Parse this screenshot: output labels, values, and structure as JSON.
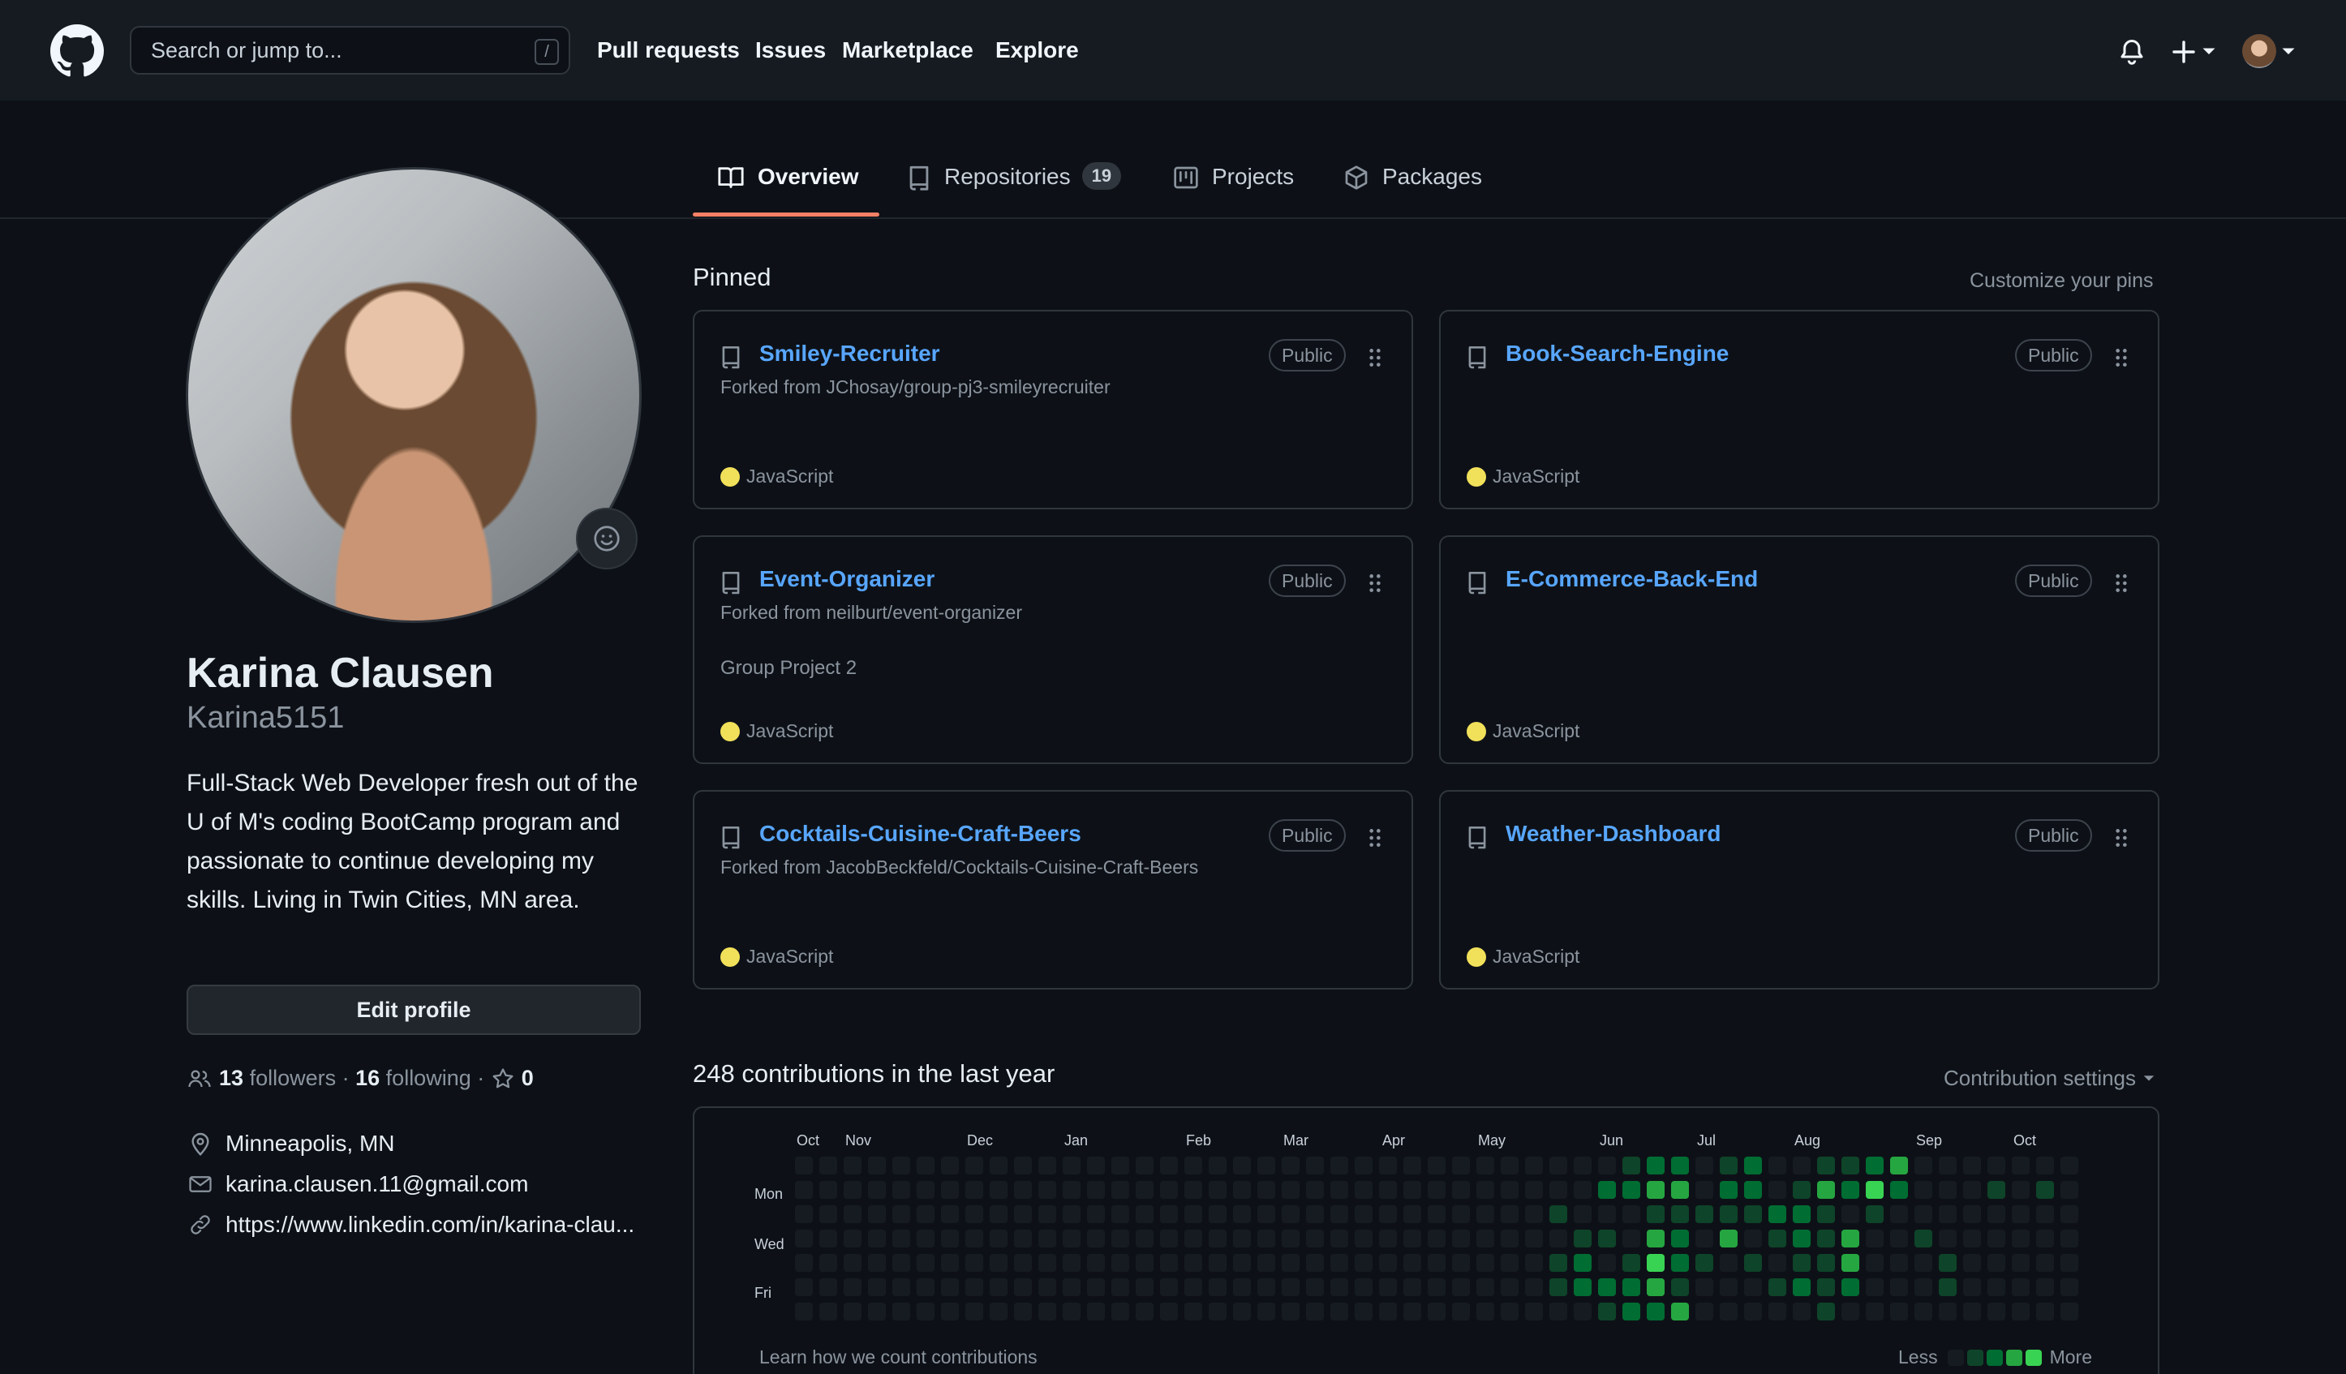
{
  "header": {
    "search_placeholder": "Search or jump to...",
    "slash_key": "/",
    "nav": [
      "Pull requests",
      "Issues",
      "Marketplace",
      "Explore"
    ]
  },
  "tabs": [
    {
      "label": "Overview",
      "active": true
    },
    {
      "label": "Repositories",
      "count": "19"
    },
    {
      "label": "Projects"
    },
    {
      "label": "Packages"
    }
  ],
  "profile": {
    "full_name": "Karina Clausen",
    "username": "Karina5151",
    "bio": "Full-Stack Web Developer fresh out of the U of M's coding BootCamp program and passionate to continue developing my skills. Living in Twin Cities, MN area.",
    "edit_label": "Edit profile",
    "followers_count": "13",
    "followers_label": "followers",
    "following_count": "16",
    "following_label": "following",
    "stars_count": "0",
    "location": "Minneapolis, MN",
    "email": "karina.clausen.11@gmail.com",
    "website": "https://www.linkedin.com/in/karina-clau..."
  },
  "pinned": {
    "title": "Pinned",
    "customize_label": "Customize your pins",
    "cards": [
      {
        "name": "Smiley-Recruiter",
        "visibility": "Public",
        "forked_from": "Forked from JChosay/group-pj3-smileyrecruiter",
        "description": "",
        "language": "JavaScript"
      },
      {
        "name": "Book-Search-Engine",
        "visibility": "Public",
        "forked_from": "",
        "description": "",
        "language": "JavaScript"
      },
      {
        "name": "Event-Organizer",
        "visibility": "Public",
        "forked_from": "Forked from neilburt/event-organizer",
        "description": "Group Project 2",
        "language": "JavaScript"
      },
      {
        "name": "E-Commerce-Back-End",
        "visibility": "Public",
        "forked_from": "",
        "description": "",
        "language": "JavaScript"
      },
      {
        "name": "Cocktails-Cuisine-Craft-Beers",
        "visibility": "Public",
        "forked_from": "Forked from JacobBeckfeld/Cocktails-Cuisine-Craft-Beers",
        "description": "",
        "language": "JavaScript"
      },
      {
        "name": "Weather-Dashboard",
        "visibility": "Public",
        "forked_from": "",
        "description": "",
        "language": "JavaScript"
      }
    ],
    "language_color": "#f1e05a"
  },
  "contributions": {
    "title": "248 contributions in the last year",
    "settings_label": "Contribution settings",
    "months": [
      "Oct",
      "Nov",
      "Dec",
      "Jan",
      "Feb",
      "Mar",
      "Apr",
      "May",
      "Jun",
      "Jul",
      "Aug",
      "Sep",
      "Oct"
    ],
    "days": [
      "Mon",
      "Wed",
      "Fri"
    ],
    "learn_label": "Learn how we count contributions",
    "legend_less": "Less",
    "legend_more": "More",
    "level_colors": [
      "#161b22",
      "#0e4429",
      "#006d32",
      "#26a641",
      "#39d353"
    ],
    "active_cells": [
      [
        31,
        2,
        1
      ],
      [
        31,
        4,
        1
      ],
      [
        31,
        5,
        1
      ],
      [
        32,
        3,
        1
      ],
      [
        32,
        4,
        2
      ],
      [
        32,
        5,
        2
      ],
      [
        33,
        1,
        2
      ],
      [
        33,
        3,
        1
      ],
      [
        33,
        5,
        2
      ],
      [
        33,
        6,
        1
      ],
      [
        34,
        0,
        1
      ],
      [
        34,
        1,
        2
      ],
      [
        34,
        4,
        1
      ],
      [
        34,
        5,
        2
      ],
      [
        34,
        6,
        2
      ],
      [
        35,
        0,
        2
      ],
      [
        35,
        1,
        3
      ],
      [
        35,
        2,
        1
      ],
      [
        35,
        3,
        3
      ],
      [
        35,
        4,
        4
      ],
      [
        35,
        5,
        3
      ],
      [
        35,
        6,
        2
      ],
      [
        36,
        0,
        2
      ],
      [
        36,
        1,
        3
      ],
      [
        36,
        2,
        1
      ],
      [
        36,
        3,
        2
      ],
      [
        36,
        4,
        2
      ],
      [
        36,
        5,
        1
      ],
      [
        36,
        6,
        3
      ],
      [
        37,
        2,
        1
      ],
      [
        37,
        4,
        1
      ],
      [
        38,
        0,
        1
      ],
      [
        38,
        1,
        2
      ],
      [
        38,
        2,
        1
      ],
      [
        38,
        3,
        3
      ],
      [
        39,
        0,
        2
      ],
      [
        39,
        1,
        2
      ],
      [
        39,
        2,
        1
      ],
      [
        39,
        4,
        1
      ],
      [
        40,
        2,
        2
      ],
      [
        40,
        3,
        1
      ],
      [
        40,
        5,
        1
      ],
      [
        41,
        1,
        1
      ],
      [
        41,
        2,
        2
      ],
      [
        41,
        3,
        2
      ],
      [
        41,
        4,
        1
      ],
      [
        41,
        5,
        2
      ],
      [
        42,
        0,
        1
      ],
      [
        42,
        1,
        3
      ],
      [
        42,
        2,
        1
      ],
      [
        42,
        3,
        1
      ],
      [
        42,
        4,
        1
      ],
      [
        42,
        5,
        1
      ],
      [
        42,
        6,
        1
      ],
      [
        43,
        0,
        1
      ],
      [
        43,
        1,
        2
      ],
      [
        43,
        3,
        3
      ],
      [
        43,
        4,
        3
      ],
      [
        43,
        5,
        2
      ],
      [
        44,
        0,
        2
      ],
      [
        44,
        1,
        4
      ],
      [
        44,
        2,
        1
      ],
      [
        45,
        0,
        3
      ],
      [
        45,
        1,
        2
      ],
      [
        46,
        3,
        1
      ],
      [
        47,
        4,
        1
      ],
      [
        47,
        5,
        1
      ],
      [
        49,
        1,
        1
      ],
      [
        51,
        1,
        1
      ]
    ]
  }
}
